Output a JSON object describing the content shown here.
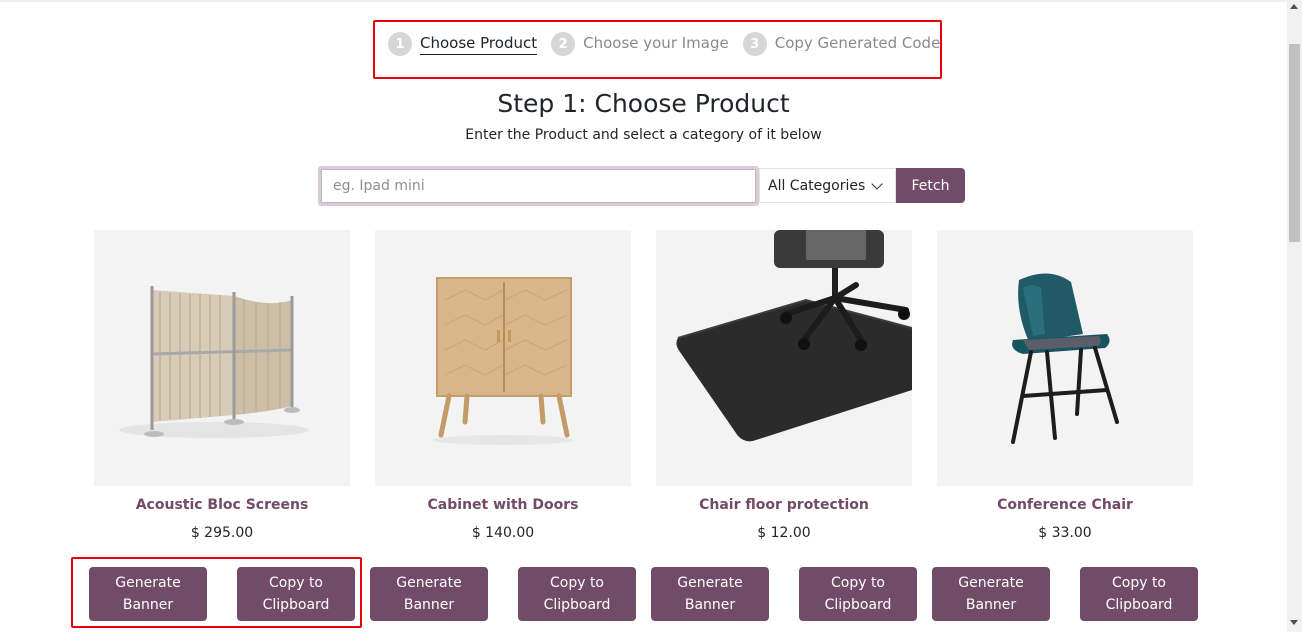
{
  "stepper": {
    "steps": [
      {
        "number": "1",
        "label": "Choose Product",
        "active": true
      },
      {
        "number": "2",
        "label": "Choose your Image",
        "active": false
      },
      {
        "number": "3",
        "label": "Copy Generated Code",
        "active": false
      }
    ]
  },
  "heading": {
    "title": "Step 1: Choose Product",
    "subtitle": "Enter the Product and select a category of it below"
  },
  "search": {
    "placeholder": "eg. Ipad mini",
    "value": "",
    "category": "All Categories",
    "fetch_label": "Fetch"
  },
  "products": [
    {
      "name": "Acoustic Bloc Screens",
      "price": "$ 295.00",
      "image_icon": "acoustic-screen-image"
    },
    {
      "name": "Cabinet with Doors",
      "price": "$ 140.00",
      "image_icon": "cabinet-image"
    },
    {
      "name": "Chair floor protection",
      "price": "$ 12.00",
      "image_icon": "chair-floor-mat-image"
    },
    {
      "name": "Conference Chair",
      "price": "$ 33.00",
      "image_icon": "conference-chair-image"
    }
  ],
  "actions": {
    "generate_banner": "Generate Banner",
    "copy_to_clipboard": "Copy to Clipboard"
  },
  "colors": {
    "accent": "#714b67",
    "highlight": "#e8000b",
    "step_inactive": "#d6d6d6"
  }
}
